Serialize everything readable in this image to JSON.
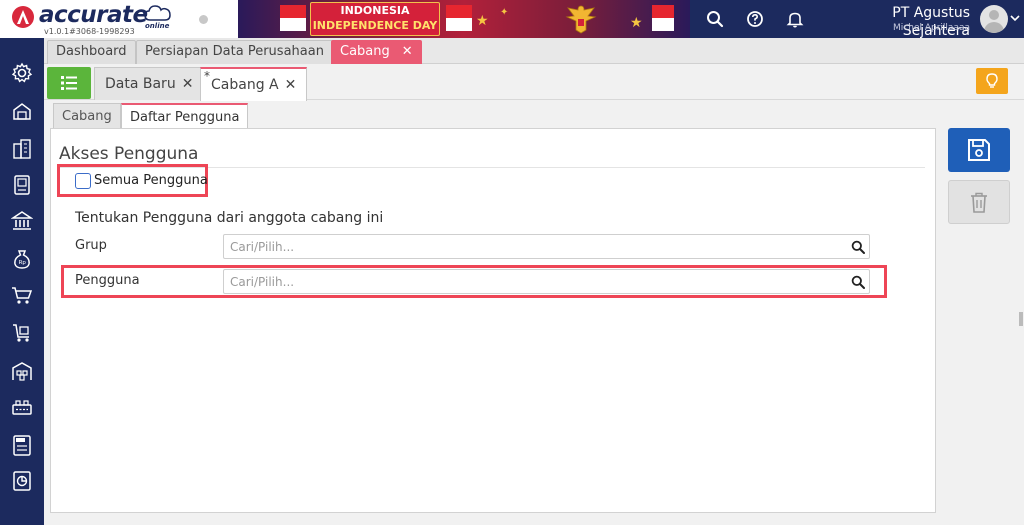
{
  "header": {
    "brand_name": "accurate",
    "brand_online": "online",
    "version": "v1.0.1#3068-1998293",
    "banner_line1": "INDONESIA",
    "banner_line2": "INDEPENDENCE DAY",
    "company": "PT Agustus Sejahtera",
    "user": "Michel Aprillaaaa",
    "icons": [
      "search-icon",
      "help-icon",
      "bell-icon",
      "avatar",
      "chevron-down-icon"
    ]
  },
  "sidebar": {
    "icons": [
      "gear-icon",
      "inventory-icon",
      "buildings-icon",
      "ledger-icon",
      "bank-icon",
      "money-bag-icon",
      "cart-icon",
      "delivery-cart-icon",
      "warehouse-icon",
      "production-icon",
      "tax-icon",
      "report-icon"
    ]
  },
  "module_tabs": {
    "items": [
      {
        "label": "Dashboard"
      },
      {
        "label": "Persiapan Data Perusahaan"
      },
      {
        "label": "Cabang"
      }
    ],
    "close_glyph": "✕",
    "count": "3"
  },
  "record_tabs": {
    "items": [
      {
        "label": "Data Baru",
        "star": ""
      },
      {
        "label": "Cabang A",
        "star": "*"
      }
    ],
    "close_glyph": "✕"
  },
  "sub_tabs": {
    "items": [
      {
        "label": "Cabang"
      },
      {
        "label": "Daftar Pengguna"
      }
    ]
  },
  "form": {
    "section_title": "Akses Pengguna",
    "all_users_label": "Semua Pengguna",
    "all_users_checked": false,
    "sub_heading": "Tentukan Pengguna dari anggota cabang ini",
    "group_label": "Grup",
    "group_placeholder": "Cari/Pilih...",
    "group_value": "",
    "user_label": "Pengguna",
    "user_placeholder": "Cari/Pilih...",
    "user_value": ""
  },
  "colors": {
    "navy": "#1c2a5e",
    "accent_pink": "#ea5a73",
    "highlight_red": "#ee4556",
    "save_blue": "#1f5fb8",
    "list_green": "#5bb53b",
    "bulb_orange": "#f4a51c"
  }
}
